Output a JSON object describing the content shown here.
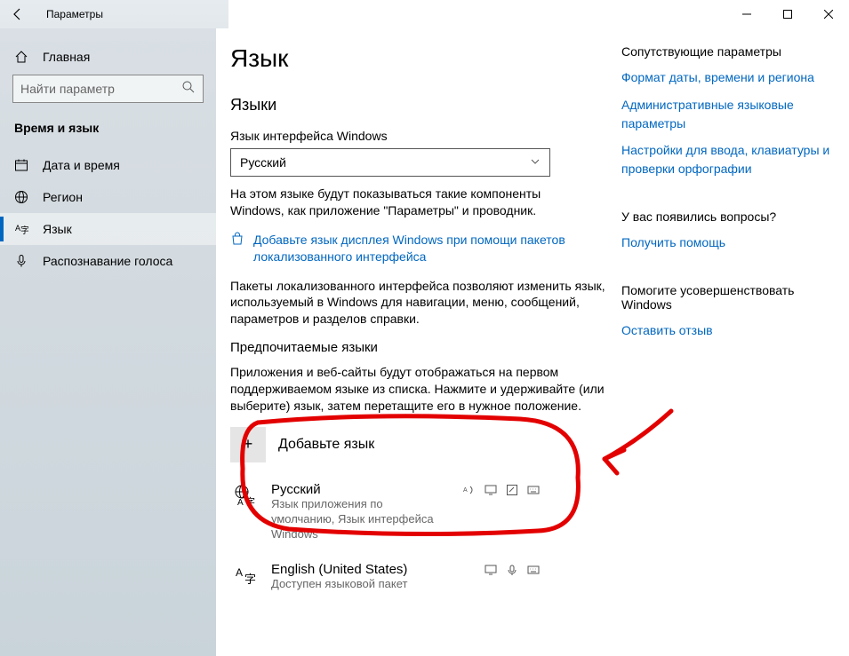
{
  "titlebar": {
    "app_name": "Параметры"
  },
  "sidebar": {
    "home": "Главная",
    "search_placeholder": "Найти параметр",
    "category": "Время и язык",
    "items": [
      {
        "icon": "calendar-icon",
        "label": "Дата и время"
      },
      {
        "icon": "globe-icon",
        "label": "Регион"
      },
      {
        "icon": "language-icon",
        "label": "Язык"
      },
      {
        "icon": "mic-icon",
        "label": "Распознавание голоса"
      }
    ]
  },
  "page": {
    "heading": "Язык",
    "languages_heading": "Языки",
    "display_lang_label": "Язык интерфейса Windows",
    "display_lang_value": "Русский",
    "display_lang_desc": "На этом языке будут показываться такие компоненты Windows, как приложение \"Параметры\" и проводник.",
    "store_link": "Добавьте язык дисплея Windows при помощи пакетов локализованного интерфейса",
    "locpack_desc": "Пакеты локализованного интерфейса позволяют изменить язык, используемый в Windows для навигации, меню, сообщений, параметров и разделов справки.",
    "preferred_heading": "Предпочитаемые языки",
    "preferred_desc": "Приложения и веб-сайты будут отображаться на первом поддерживаемом языке из списка. Нажмите и удерживайте (или выберите) язык, затем перетащите его в нужное положение.",
    "add_language": "Добавьте язык",
    "langs": [
      {
        "name": "Русский",
        "sub": "Язык приложения по умолчанию, Язык интерфейса Windows"
      },
      {
        "name": "English (United States)",
        "sub": "Доступен языковой пакет"
      }
    ]
  },
  "related": {
    "title": "Сопутствующие параметры",
    "links": [
      "Формат даты, времени и региона",
      "Административные языковые параметры",
      "Настройки для ввода, клавиатуры и проверки орфографии"
    ],
    "help_title": "У вас появились вопросы?",
    "help_link": "Получить помощь",
    "feedback_title": "Помогите усовершенствовать Windows",
    "feedback_link": "Оставить отзыв"
  }
}
